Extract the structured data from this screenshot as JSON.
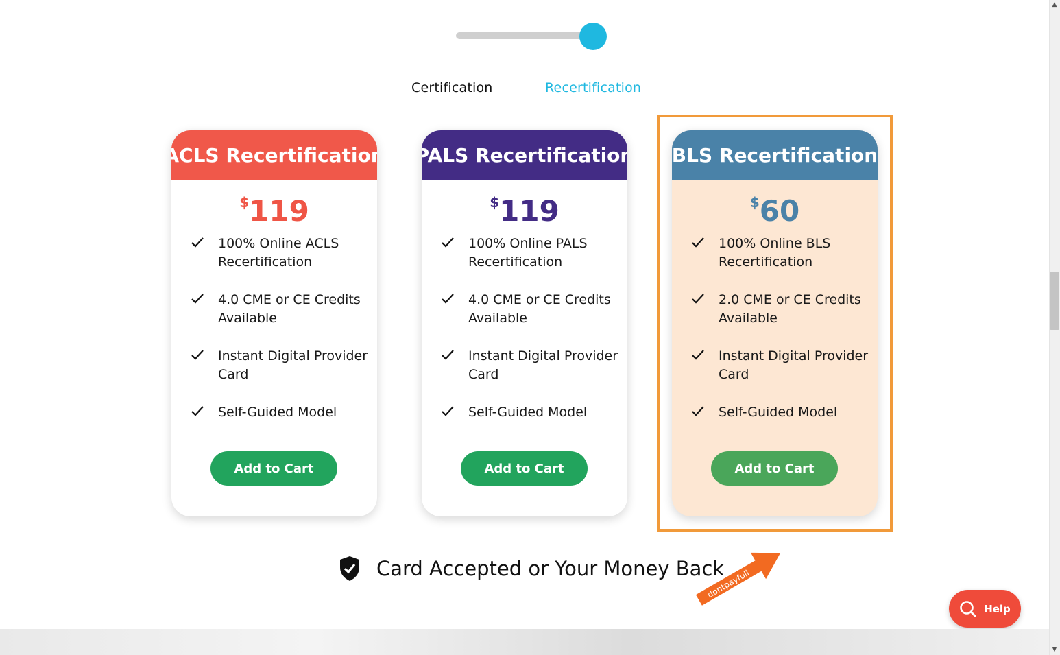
{
  "toggle": {
    "active_tab": "Recertification",
    "accent": "#1fb8e0"
  },
  "tabs": {
    "certification": "Certification",
    "recertification": "Recertification"
  },
  "cards": [
    {
      "title": "ACLS Recertification",
      "currency": "$",
      "price": "119",
      "header_color": "#f0584a",
      "price_color": "#ef5546",
      "features": [
        "100% Online ACLS Recertification",
        "4.0 CME or CE Credits Available",
        "Instant Digital Provider Card",
        "Self-Guided Model"
      ],
      "button": "Add to Cart"
    },
    {
      "title": "PALS Recertification",
      "currency": "$",
      "price": "119",
      "header_color": "#432c85",
      "price_color": "#432c85",
      "features": [
        "100% Online PALS Recertification",
        "4.0 CME or CE Credits Available",
        "Instant Digital Provider Card",
        "Self-Guided Model"
      ],
      "button": "Add to Cart"
    },
    {
      "title": "BLS Recertification",
      "currency": "$",
      "price": "60",
      "header_color": "#4a82a8",
      "price_color": "#4a82a8",
      "features": [
        "100% Online BLS Recertification",
        "2.0 CME or CE Credits Available",
        "Instant Digital Provider Card",
        "Self-Guided Model"
      ],
      "button": "Add to Cart"
    }
  ],
  "guarantee": {
    "text": "Card Accepted or Your Money Back",
    "icon": "shield-check-icon"
  },
  "arrow_badge": {
    "text": "dontpayfull",
    "color": "#f26a21"
  },
  "help": {
    "label": "Help",
    "icon": "search-icon",
    "color": "#ef4b3a"
  },
  "colors": {
    "button_green": "#22a45d",
    "button_green_highlight": "#4aa65a",
    "highlight_frame": "#f19a3a"
  }
}
